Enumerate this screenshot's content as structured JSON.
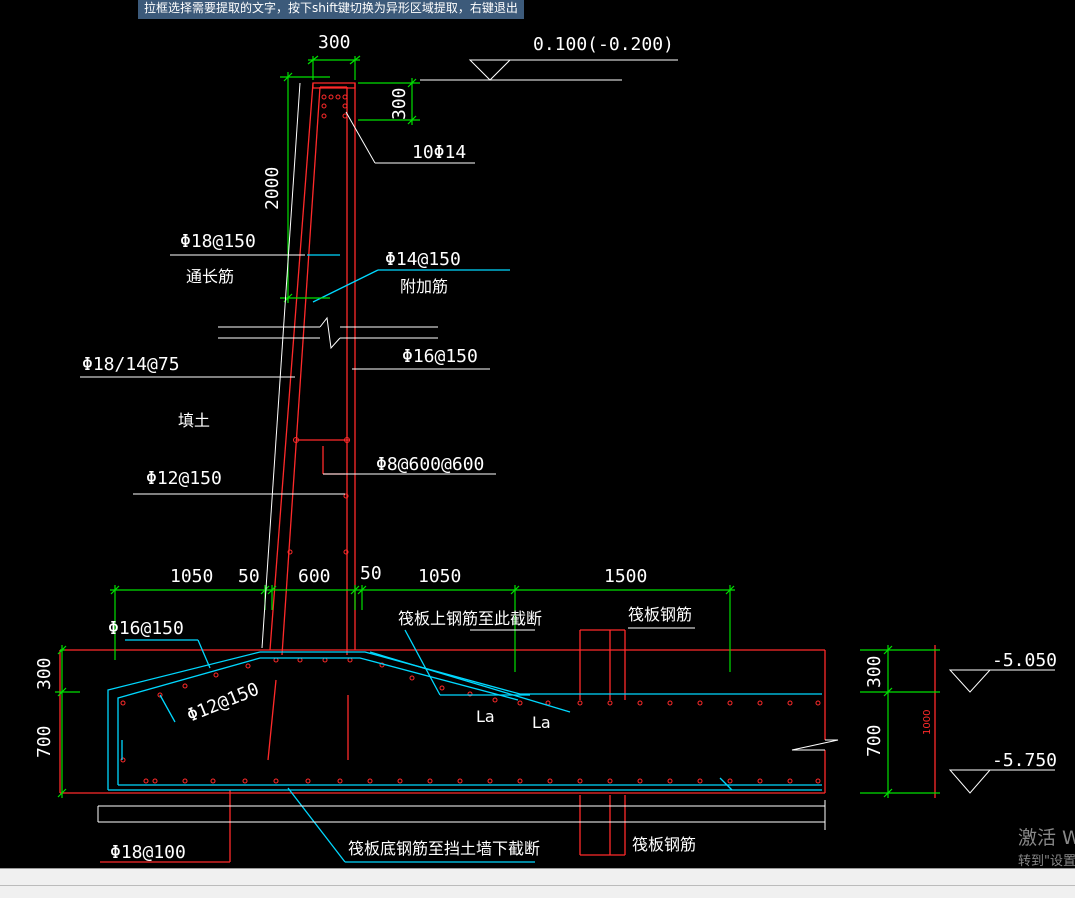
{
  "tooltip": "拉框选择需要提取的文字，按下shift键切换为异形区域提取，右键退出",
  "labels": {
    "top_width": "300",
    "elev_top": "0.100(-0.200)",
    "dim_300_v": "300",
    "rebar_10d14": "10Φ14",
    "dim_2000": "2000",
    "rebar_d18_150": "Φ18@150",
    "tongchang": "通长筋",
    "rebar_d14_150": "Φ14@150",
    "fujia": "附加筋",
    "rebar_d18_14_75": "Φ18/14@75",
    "rebar_d16_150_right": "Φ16@150",
    "tiantu": "填土",
    "rebar_d8_600": "Φ8@600@600",
    "rebar_d12_150_wall": "Φ12@150",
    "dim_1050_left": "1050",
    "dim_50_left": "50",
    "dim_600": "600",
    "dim_50_right": "50",
    "dim_1050_right": "1050",
    "dim_1500": "1500",
    "raft_top_cut": "筏板上钢筋至此截断",
    "raft_rebar_top": "筏板钢筋",
    "rebar_d16_150_left": "Φ16@150",
    "rebar_d12_150_slope": "Φ12@150",
    "la1": "La",
    "la2": "La",
    "dim_300_left": "300",
    "dim_700_left": "700",
    "dim_300_right": "300",
    "dim_700_right": "700",
    "dim_1000": "1000",
    "elev_5050": "-5.050",
    "elev_5750": "-5.750",
    "rebar_d18_100": "Φ18@100",
    "raft_bottom_cut": "筏板底钢筋至挡土墙下截断",
    "raft_rebar_bottom": "筏板钢筋"
  },
  "watermark": {
    "line1": "激活 W",
    "line2": "转到\"设置"
  },
  "colors": {
    "background": "#000000",
    "concrete": "#ff2a2a",
    "rebar": "#00d8ff",
    "dimension": "#00e000",
    "text": "#ffffff"
  }
}
